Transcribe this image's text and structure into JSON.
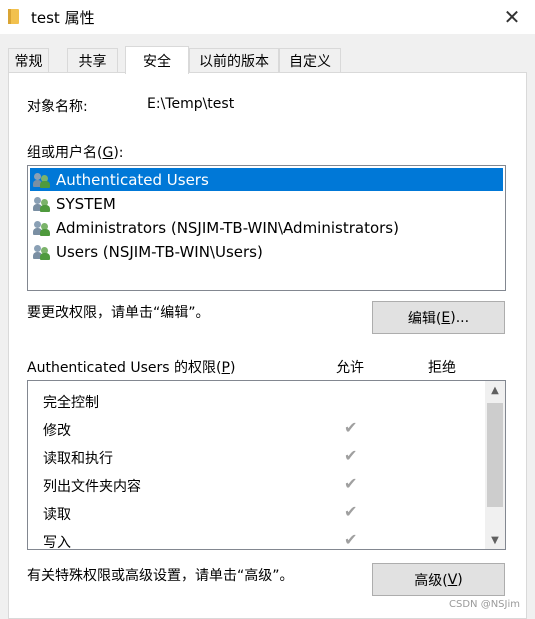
{
  "window": {
    "title": "test 属性",
    "close_glyph": "✕"
  },
  "tabs": [
    {
      "label": "常规"
    },
    {
      "label": "共享"
    },
    {
      "label": "安全",
      "active": true
    },
    {
      "label": "以前的版本"
    },
    {
      "label": "自定义"
    }
  ],
  "security": {
    "object_label": "对象名称:",
    "object_value": "E:\\Temp\\test",
    "groups_label_pre": "组或用户名(",
    "groups_label_key": "G",
    "groups_label_post": "):",
    "principals": [
      {
        "name": "Authenticated Users",
        "selected": true
      },
      {
        "name": "SYSTEM"
      },
      {
        "name": "Administrators (NSJIM-TB-WIN\\Administrators)"
      },
      {
        "name": "Users (NSJIM-TB-WIN\\Users)"
      }
    ],
    "edit_hint": "要更改权限，请单击“编辑”。",
    "edit_button_pre": "编辑(",
    "edit_button_key": "E",
    "edit_button_post": ")...",
    "perm_header_pre": "Authenticated Users 的权限(",
    "perm_header_key": "P",
    "perm_header_post": ")",
    "allow_label": "允许",
    "deny_label": "拒绝",
    "check_glyph": "✔",
    "permissions": [
      {
        "name": "完全控制",
        "allow": false,
        "deny": false
      },
      {
        "name": "修改",
        "allow": true,
        "deny": false
      },
      {
        "name": "读取和执行",
        "allow": true,
        "deny": false
      },
      {
        "name": "列出文件夹内容",
        "allow": true,
        "deny": false
      },
      {
        "name": "读取",
        "allow": true,
        "deny": false
      },
      {
        "name": "写入",
        "allow": true,
        "deny": false
      }
    ],
    "advanced_hint": "有关特殊权限或高级设置，请单击“高级”。",
    "advanced_button_pre": "高级(",
    "advanced_button_key": "V",
    "advanced_button_post": ")"
  },
  "watermark": "CSDN @NSJim"
}
